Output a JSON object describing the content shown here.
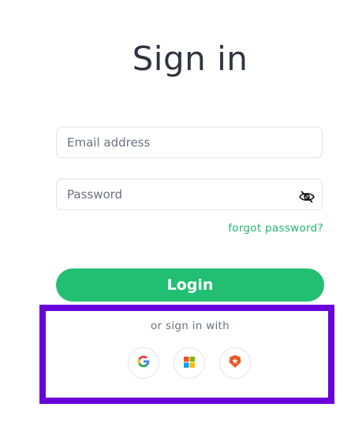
{
  "page": {
    "title": "Sign in"
  },
  "form": {
    "email": {
      "placeholder": "Email address",
      "value": ""
    },
    "password": {
      "placeholder": "Password",
      "value": ""
    },
    "forgot_label": "forgot password?",
    "login_label": "Login"
  },
  "social": {
    "label": "or sign in with",
    "providers": [
      {
        "name": "Google",
        "icon": "google-icon"
      },
      {
        "name": "Microsoft",
        "icon": "microsoft-icon"
      },
      {
        "name": "Auth0",
        "icon": "auth0-icon"
      }
    ]
  },
  "colors": {
    "accent": "#22bf72",
    "link": "#22b573",
    "highlight": "#6a00d9",
    "title": "#2f3440"
  }
}
